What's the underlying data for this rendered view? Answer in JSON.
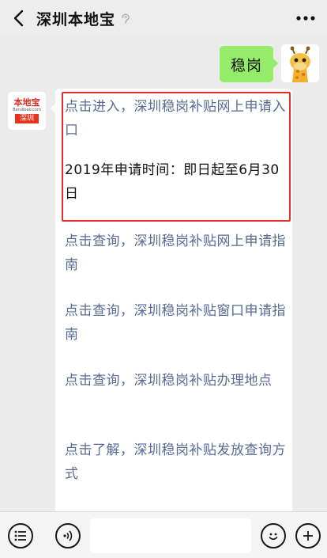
{
  "header": {
    "title": "深圳本地宝",
    "back_icon": "chevron-left-icon",
    "earpiece_icon": "earpiece-icon",
    "more_icon": "more-dots-icon"
  },
  "outgoing": {
    "text": "稳岗",
    "avatar_icon": "giraffe-avatar"
  },
  "bot_avatar": {
    "logo_main": "本地宝",
    "logo_sub": "Bendibao.com",
    "logo_tag": "深圳"
  },
  "reply": {
    "highlighted": {
      "link_text": "点击进入，深圳稳岗补贴网上申请入口",
      "info_text": "2019年申请时间：即日起至6月30日",
      "border_color": "#e0312b"
    },
    "links": [
      "点击查询，深圳稳岗补贴网上申请指南",
      "点击查询，深圳稳岗补贴窗口申请指南",
      "点击查询，深圳稳岗补贴办理地点",
      "点击了解，深圳稳岗补贴发放查询方式"
    ]
  },
  "bottom_bar": {
    "menu_icon": "menu-list-icon",
    "voice_icon": "voice-icon",
    "input_value": "",
    "emoji_icon": "emoji-icon",
    "plus_icon": "plus-icon"
  },
  "colors": {
    "link": "#576b95",
    "outgoing_bubble": "#95ec69",
    "background": "#ebebeb"
  }
}
